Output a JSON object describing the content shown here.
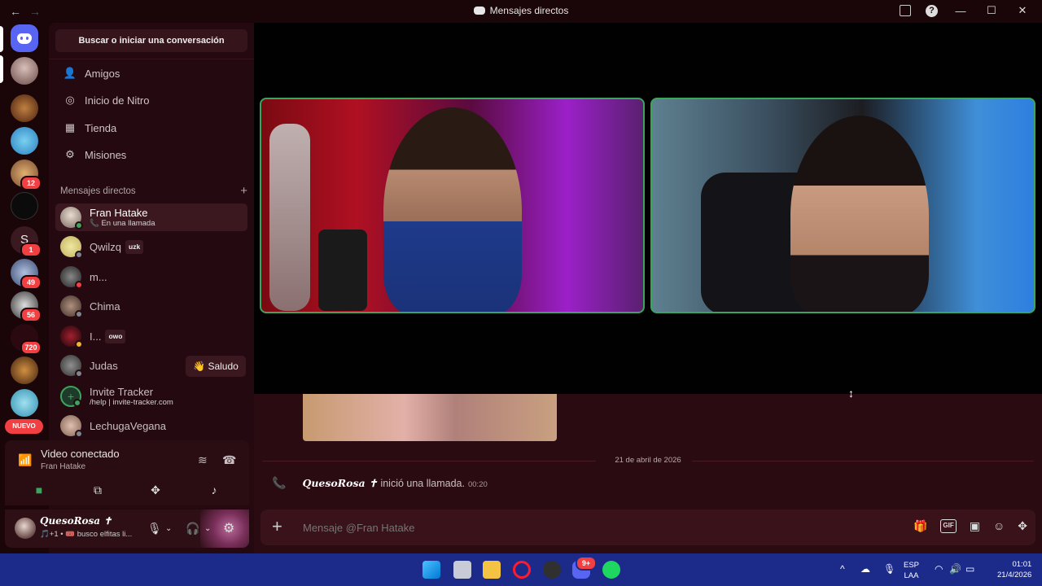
{
  "window": {
    "title": "Mensajes directos",
    "back": "←",
    "forward": "→",
    "help": "?",
    "minimize": "—",
    "maximize": "☐",
    "close": "✕"
  },
  "servers": {
    "badges": [
      "12",
      "1",
      "49",
      "56",
      "720"
    ],
    "letter_server": "S",
    "new_label": "NUEVO"
  },
  "sidebar": {
    "search_label": "Buscar o iniciar una conversación",
    "nav": [
      {
        "label": "Amigos",
        "icon": "friends-icon"
      },
      {
        "label": "Inicio de Nitro",
        "icon": "nitro-icon"
      },
      {
        "label": "Tienda",
        "icon": "shop-icon"
      },
      {
        "label": "Misiones",
        "icon": "quests-icon"
      }
    ],
    "dm_header": "Mensajes directos",
    "dm_add": "+",
    "dms": [
      {
        "name": "Fran Hatake",
        "sub": "📞 En una llamada",
        "status": "online"
      },
      {
        "name": "Qwilzq",
        "tag": "uzk",
        "status": "offline"
      },
      {
        "name": "m...",
        "status": "dnd"
      },
      {
        "name": "Chima",
        "status": "offline"
      },
      {
        "name": "I...",
        "tag": "owo",
        "status": "idle"
      },
      {
        "name": "Judas",
        "status": "offline"
      },
      {
        "name": "Invite Tracker",
        "sub": "/help | invite-tracker.com",
        "status": "online"
      },
      {
        "name": "LechugaVegana",
        "status": "offline"
      }
    ],
    "saludo_label": "👋 Saludo"
  },
  "voice": {
    "title": "Video conectado",
    "subtitle": "Fran Hatake"
  },
  "user": {
    "name": "QuesoRosa ✝",
    "status": "🎵+1 • 🎟️ busco elfitas li..."
  },
  "chat": {
    "date_divider": "21 de abril de 2026",
    "call_user": "QuesoRosa ✝",
    "call_text": "inició una llamada.",
    "call_time": "00:20",
    "composer_placeholder": "Mensaje @Fran Hatake",
    "composer_add": "+",
    "gif_label": "GIF"
  },
  "taskbar": {
    "discord_badge": "9+",
    "lang_top": "ESP",
    "lang_bottom": "LAA",
    "time": "01:01",
    "date": "21/4/2026"
  },
  "colors": {
    "accent": "#5865f2",
    "online": "#3ba55d",
    "dnd": "#f23f42",
    "idle": "#f0b232",
    "taskbar": "#1c2b8a"
  }
}
